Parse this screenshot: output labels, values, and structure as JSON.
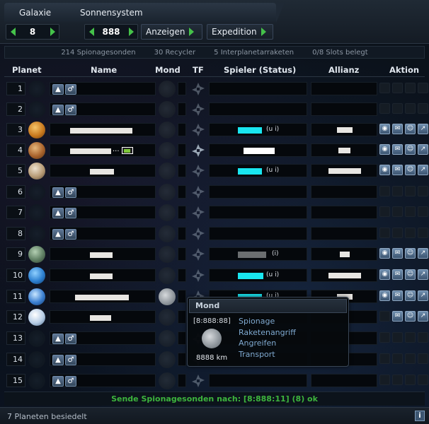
{
  "tabs": {
    "galaxy_label": "Galaxie",
    "system_label": "Sonnensystem"
  },
  "nav": {
    "galaxy_value": "8",
    "system_value": "888",
    "show_label": "Anzeigen",
    "expedition_label": "Expedition"
  },
  "stats": {
    "probes": "214 Spionagesonden",
    "recyclers": "30 Recycler",
    "missiles": "5 Interplanetarraketen",
    "slots": "0/8 Slots belegt"
  },
  "headers": {
    "planet": "Planet",
    "name": "Name",
    "moon": "Mond",
    "tf": "TF",
    "player": "Spieler (Status)",
    "alliance": "Allianz",
    "action": "Aktion"
  },
  "rows": [
    {
      "pos": "1"
    },
    {
      "pos": "2"
    },
    {
      "pos": "3",
      "status": "(u i)"
    },
    {
      "pos": "4",
      "name_suffix": "..."
    },
    {
      "pos": "5",
      "status": "(u i)"
    },
    {
      "pos": "6"
    },
    {
      "pos": "7"
    },
    {
      "pos": "8"
    },
    {
      "pos": "9",
      "status": "(i)"
    },
    {
      "pos": "10",
      "status": "(u i)"
    },
    {
      "pos": "11",
      "status": "(u i)"
    },
    {
      "pos": "12"
    },
    {
      "pos": "13"
    },
    {
      "pos": "14"
    },
    {
      "pos": "15"
    }
  ],
  "colors": {
    "accent_green": "#45c24a",
    "player_cyan": "#19e6f0",
    "player_gray": "#6b6e70",
    "send_green": "#3db43d",
    "link_blue": "#7fa9d0"
  },
  "tooltip": {
    "title": "Mond",
    "coords": "[8:888:88]",
    "size": "8888 km",
    "actions": [
      "Spionage",
      "Raketenangriff",
      "Angreifen",
      "Transport"
    ]
  },
  "send_message": "Sende Spionagesonden nach: [8:888:11] (8) ok",
  "footer": {
    "colonized": "7 Planeten besiedelt",
    "info_icon": "i"
  }
}
